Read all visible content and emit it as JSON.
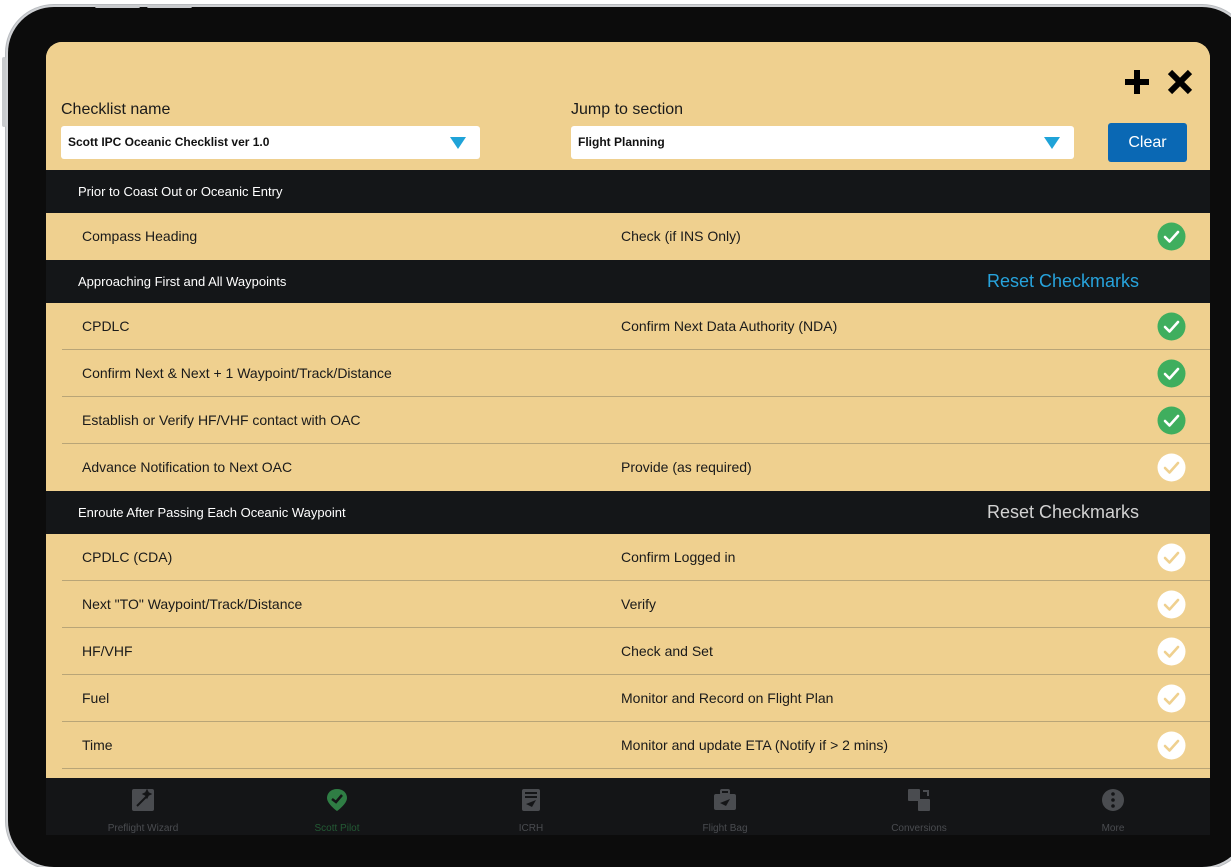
{
  "header": {
    "checklist_label": "Checklist name",
    "checklist_value": "Scott IPC Oceanic Checklist ver 1.0",
    "jump_label": "Jump to section",
    "jump_value": "Flight Planning",
    "clear_label": "Clear"
  },
  "sections": [
    {
      "title": "Prior to Coast Out or Oceanic Entry",
      "reset_label": "",
      "rows": [
        {
          "item": "Compass Heading",
          "action": "Check (if INS Only)",
          "checked": true
        }
      ]
    },
    {
      "title": "Approaching First and All Waypoints",
      "reset_label": "Reset Checkmarks",
      "reset_active": true,
      "rows": [
        {
          "item": "CPDLC",
          "action": "Confirm Next Data Authority (NDA)",
          "checked": true
        },
        {
          "item": "Confirm Next & Next + 1 Waypoint/Track/Distance",
          "action": "",
          "checked": true
        },
        {
          "item": "Establish or Verify HF/VHF contact with OAC",
          "action": "",
          "checked": true
        },
        {
          "item": "Advance Notification to Next OAC",
          "action": "Provide (as required)",
          "checked": false
        }
      ]
    },
    {
      "title": "Enroute After Passing Each Oceanic Waypoint",
      "reset_label": "Reset Checkmarks",
      "reset_active": false,
      "rows": [
        {
          "item": "CPDLC (CDA)",
          "action": "Confirm Logged in",
          "checked": false
        },
        {
          "item": "Next \"TO\" Waypoint/Track/Distance",
          "action": "Verify",
          "checked": false
        },
        {
          "item": "HF/VHF",
          "action": "Check and Set",
          "checked": false
        },
        {
          "item": "Fuel",
          "action": "Monitor and Record on Flight Plan",
          "checked": false
        },
        {
          "item": "Time",
          "action": "Monitor and update ETA (Notify if > 2 mins)",
          "checked": false
        }
      ]
    }
  ],
  "tabs": [
    {
      "label": "Preflight Wizard",
      "icon": "wizard-icon",
      "selected": false
    },
    {
      "label": "Scott Pilot",
      "icon": "scott-pilot-icon",
      "selected": true
    },
    {
      "label": "ICRH",
      "icon": "icrh-icon",
      "selected": false
    },
    {
      "label": "Flight Bag",
      "icon": "flight-bag-icon",
      "selected": false
    },
    {
      "label": "Conversions",
      "icon": "conversions-icon",
      "selected": false
    },
    {
      "label": "More",
      "icon": "more-icon",
      "selected": false
    }
  ],
  "colors": {
    "accent": "#27a3dc",
    "check_green": "#3fae5e",
    "background": "#efd08f",
    "section_bar": "#141618",
    "clear_button": "#0a68b4"
  }
}
